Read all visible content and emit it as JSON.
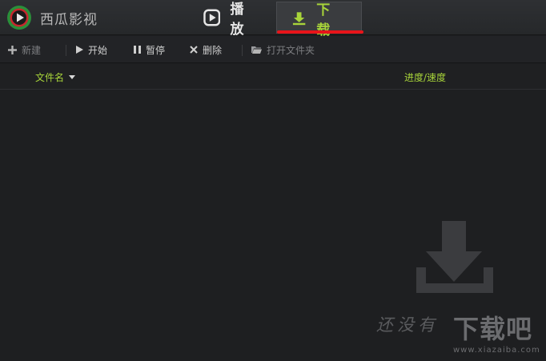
{
  "app": {
    "title": "西瓜影视"
  },
  "tabs": [
    {
      "label": "播 放",
      "active": false
    },
    {
      "label": "下 载",
      "active": true
    }
  ],
  "toolbar": {
    "new_label": "新建",
    "start_label": "开始",
    "pause_label": "暂停",
    "delete_label": "删除",
    "open_folder_label": "打开文件夹"
  },
  "table": {
    "columns": [
      "文件名",
      "进度/速度"
    ]
  },
  "watermark": {
    "slogan": "还没有",
    "brand": "下载吧",
    "url": "www.xiazaiba.com"
  },
  "colors": {
    "accent": "#a8d43a",
    "annotation": "#e8141a",
    "background": "#1e1f21"
  },
  "icons": [
    "app-logo-icon",
    "play-circle-icon",
    "download-icon",
    "plus-icon",
    "play-icon",
    "pause-icon",
    "close-icon",
    "folder-icon",
    "caret-down-icon"
  ]
}
